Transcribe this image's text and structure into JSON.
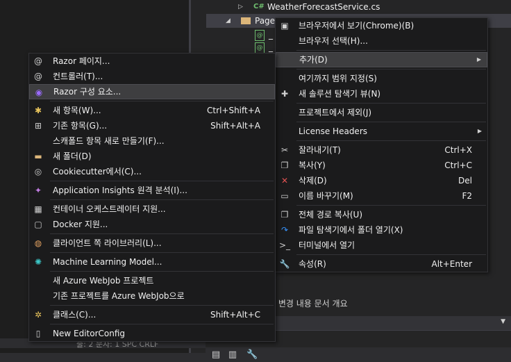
{
  "solution_explorer": {
    "file_row": "WeatherForecastService.cs",
    "file_badge": "C#",
    "folder_row": "Page",
    "child_1": "_",
    "child_2": "_",
    "bottom_tabs": "it 변경 내용   문서 개요",
    "status_left": "줄: 2    문자: 1    SPC    CRLF"
  },
  "right_menu": {
    "items": [
      {
        "label": "브라우저에서 보기(Chrome)(B)",
        "shortcut": "",
        "icon": "browser-icon"
      },
      {
        "label": "브라우저 선택(H)...",
        "shortcut": "",
        "icon": ""
      },
      {
        "label": "추가(D)",
        "shortcut": "",
        "icon": "",
        "submenu": true
      },
      {
        "label": "여기까지 범위 지정(S)",
        "shortcut": "",
        "icon": ""
      },
      {
        "label": "새 솔루션 탐색기 뷰(N)",
        "shortcut": "",
        "icon": "new-view-icon"
      },
      {
        "label": "프로젝트에서 제외(J)",
        "shortcut": "",
        "icon": ""
      },
      {
        "label": "License Headers",
        "shortcut": "",
        "icon": "",
        "submenu": true
      },
      {
        "label": "잘라내기(T)",
        "shortcut": "Ctrl+X",
        "icon": "cut-icon"
      },
      {
        "label": "복사(Y)",
        "shortcut": "Ctrl+C",
        "icon": "copy-icon"
      },
      {
        "label": "삭제(D)",
        "shortcut": "Del",
        "icon": "delete-icon"
      },
      {
        "label": "이름 바꾸기(M)",
        "shortcut": "F2",
        "icon": "rename-icon"
      },
      {
        "label": "전체 경로 복사(U)",
        "shortcut": "",
        "icon": "copy-path-icon"
      },
      {
        "label": "파일 탐색기에서 폴더 열기(X)",
        "shortcut": "",
        "icon": "open-folder-icon"
      },
      {
        "label": "터미널에서 열기",
        "shortcut": "",
        "icon": "terminal-icon"
      },
      {
        "label": "속성(R)",
        "shortcut": "Alt+Enter",
        "icon": "wrench-icon"
      }
    ]
  },
  "left_menu": {
    "items": [
      {
        "label": "Razor 페이지...",
        "shortcut": "",
        "icon": "razor-page-icon"
      },
      {
        "label": "컨트롤러(T)...",
        "shortcut": "",
        "icon": "controller-icon"
      },
      {
        "label": "Razor 구성 요소...",
        "shortcut": "",
        "icon": "razor-component-icon"
      },
      {
        "label": "새 항목(W)...",
        "shortcut": "Ctrl+Shift+A",
        "icon": "new-item-icon"
      },
      {
        "label": "기존 항목(G)...",
        "shortcut": "Shift+Alt+A",
        "icon": "existing-item-icon"
      },
      {
        "label": "스캐폴드 항목 새로 만들기(F)...",
        "shortcut": "",
        "icon": ""
      },
      {
        "label": "새 폴더(D)",
        "shortcut": "",
        "icon": "new-folder-icon"
      },
      {
        "label": "Cookiecutter에서(C)...",
        "shortcut": "",
        "icon": "cookie-icon"
      },
      {
        "label": "Application Insights 원격 분석(I)...",
        "shortcut": "",
        "icon": "insights-icon"
      },
      {
        "label": "컨테이너 오케스트레이터 지원...",
        "shortcut": "",
        "icon": "container-icon"
      },
      {
        "label": "Docker 지원...",
        "shortcut": "",
        "icon": "docker-icon"
      },
      {
        "label": "클라이언트 쪽 라이브러리(L)...",
        "shortcut": "",
        "icon": "globe-icon"
      },
      {
        "label": "Machine Learning Model...",
        "shortcut": "",
        "icon": "ml-icon"
      },
      {
        "label": "새 Azure WebJob 프로젝트",
        "shortcut": "",
        "icon": ""
      },
      {
        "label": "기존 프로젝트를 Azure WebJob으로",
        "shortcut": "",
        "icon": ""
      },
      {
        "label": "클래스(C)...",
        "shortcut": "Shift+Alt+C",
        "icon": "class-icon"
      },
      {
        "label": "New EditorConfig",
        "shortcut": "",
        "icon": "file-icon"
      }
    ]
  }
}
